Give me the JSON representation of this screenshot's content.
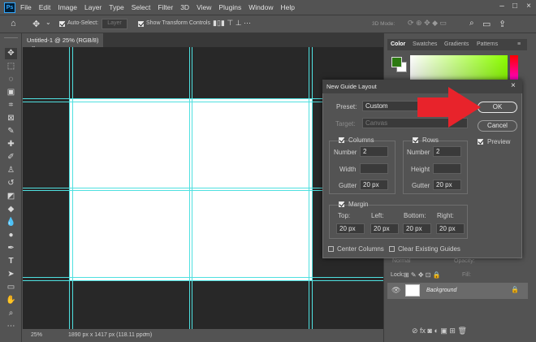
{
  "menu": [
    "File",
    "Edit",
    "Image",
    "Layer",
    "Type",
    "Select",
    "Filter",
    "3D",
    "View",
    "Plugins",
    "Window",
    "Help"
  ],
  "options_bar": {
    "auto_select_label": "Auto-Select:",
    "auto_select_value": "Layer",
    "show_transform_label": "Show Transform Controls",
    "mode_label": "3D Mode:"
  },
  "document": {
    "tab_title": "Untitled-1 @ 25% (RGB/8)",
    "close": "×"
  },
  "status": {
    "zoom": "25%",
    "size": "1890 px x 1417 px (118.11 ppcm)"
  },
  "panels": {
    "tabs": [
      "Color",
      "Swatches",
      "Gradients",
      "Patterns"
    ],
    "layers": {
      "row_opacity": "Normal",
      "opacity_label": "Opacity:",
      "fill_label": "Fill:",
      "lock_label": "Lock:",
      "layer_name": "Background"
    }
  },
  "dialog": {
    "title": "New Guide Layout",
    "preset_label": "Preset:",
    "preset_value": "Custom",
    "target_label": "Target:",
    "target_value": "Canvas",
    "columns": {
      "label": "Columns",
      "number_label": "Number",
      "number": "2",
      "width_label": "Width",
      "width": "",
      "gutter_label": "Gutter",
      "gutter": "20 px"
    },
    "rows": {
      "label": "Rows",
      "number_label": "Number",
      "number": "2",
      "height_label": "Height",
      "height": "",
      "gutter_label": "Gutter",
      "gutter": "20 px"
    },
    "margin": {
      "label": "Margin",
      "top_label": "Top:",
      "top": "20 px",
      "left_label": "Left:",
      "left": "20 px",
      "bottom_label": "Bottom:",
      "bottom": "20 px",
      "right_label": "Right:",
      "right": "20 px"
    },
    "center_columns": "Center Columns",
    "clear_guides": "Clear Existing Guides",
    "ok": "OK",
    "cancel": "Cancel",
    "preview": "Preview"
  },
  "colors": {
    "accent_arrow": "#e8232b",
    "guide": "#4fe0e0",
    "foreground": "#2d7a12"
  }
}
